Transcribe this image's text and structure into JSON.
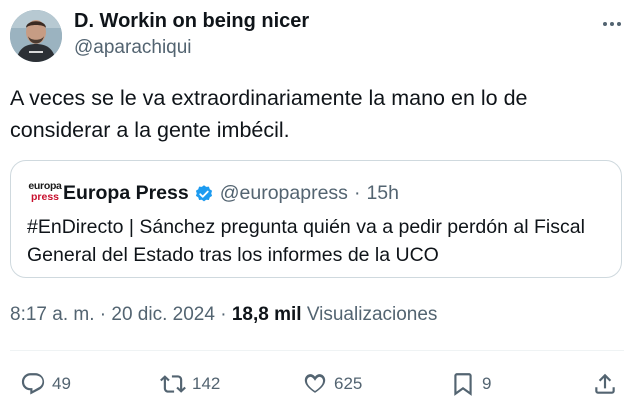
{
  "author": {
    "name": "D. Workin on being nicer",
    "handle": "@aparachiqui",
    "avatar_icon": "avatar-photo"
  },
  "tweet": {
    "text": "A veces se le va extraordinariamente la mano en lo de considerar a la gente imbécil."
  },
  "quoted_tweet": {
    "logo_line1": "europa",
    "logo_line2": "press",
    "name": "Europa Press",
    "handle": "@europapress",
    "separator": "·",
    "time": "15h",
    "text": "#EnDirecto | Sánchez pregunta quién va a pedir perdón al Fiscal General del Estado tras los informes de la UCO",
    "verified_color": "#1d9bf0"
  },
  "meta": {
    "time": "8:17 a. m.",
    "separator": "·",
    "date": "20 dic. 2024",
    "separator2": "·",
    "views_count": "18,8 mil",
    "views_label": "Visualizaciones"
  },
  "actions": {
    "replies": "49",
    "retweets": "142",
    "likes": "625",
    "bookmarks": "9"
  },
  "colors": {
    "text": "#0f1419",
    "secondary": "#536471",
    "border": "#cfd9de",
    "brand_red": "#c8102e"
  }
}
